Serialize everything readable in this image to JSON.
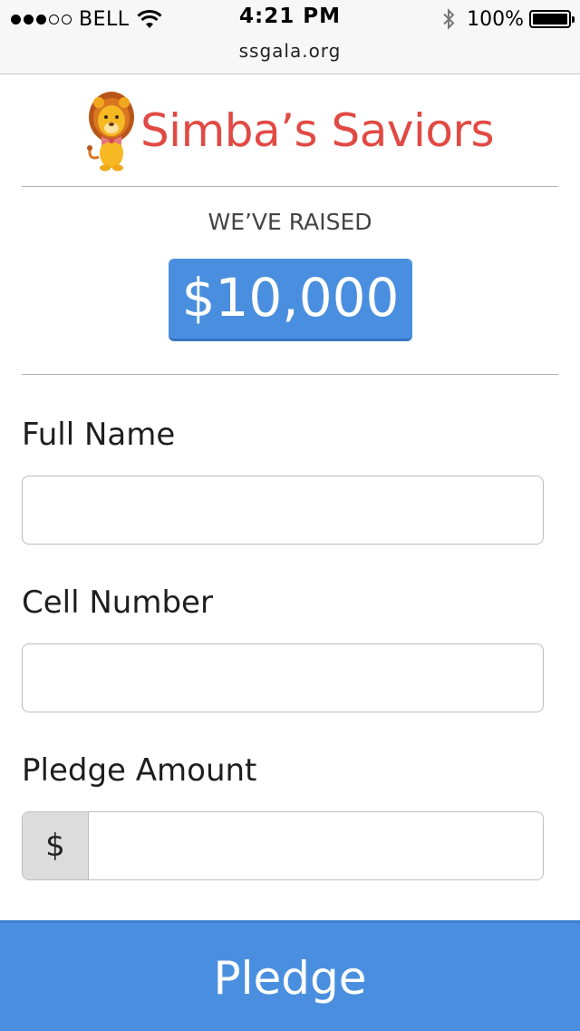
{
  "status_bar": {
    "carrier": "BELL",
    "time": "4:21 PM",
    "battery": "100%"
  },
  "browser": {
    "url": "ssgala.org"
  },
  "header": {
    "brand": "Simba’s Saviors",
    "logo_icon": "lion-mascot-icon",
    "brand_color": "#e14a44"
  },
  "raised": {
    "label": "WE’VE RAISED",
    "amount": "$10,000"
  },
  "form": {
    "full_name": {
      "label": "Full Name",
      "value": "",
      "placeholder": ""
    },
    "cell_number": {
      "label": "Cell Number",
      "value": "",
      "placeholder": ""
    },
    "pledge_amount": {
      "label": "Pledge Amount",
      "prefix": "$",
      "value": "",
      "placeholder": ""
    }
  },
  "submit": {
    "label": "Pledge"
  },
  "colors": {
    "accent": "#4a8fdf",
    "input_border": "#bdbdbd",
    "divider": "#b3b3b3"
  }
}
